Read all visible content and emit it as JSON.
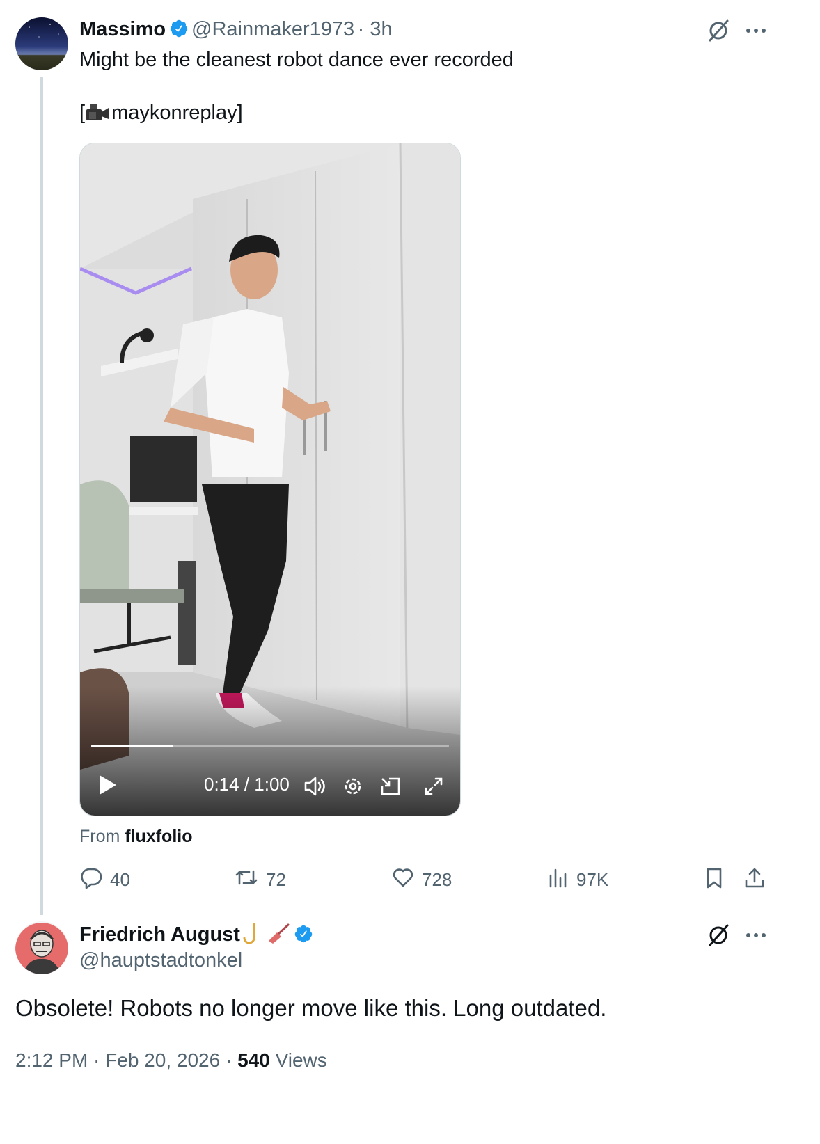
{
  "tweet1": {
    "display_name": "Massimo",
    "handle": "@Rainmaker1973",
    "time": "· 3h",
    "text_line1": "Might be the cleanest robot dance ever recorded",
    "credit_open": "[",
    "credit_name": "maykonreplay]",
    "video": {
      "time_display": "0:14 / 1:00",
      "progress": 0.23
    },
    "source_prefix": "From",
    "source_name": "fluxfolio",
    "actions": {
      "replies": "40",
      "retweets": "72",
      "likes": "728",
      "views": "97K"
    }
  },
  "tweet2": {
    "display_name": "Friedrich August",
    "handle": "@hauptstadtonkel",
    "text": "Obsolete! Robots no longer move like this. Long outdated.",
    "timestamp": "2:12 PM · Feb 20, 2026 ·",
    "views_count": "540",
    "views_label": "Views"
  },
  "colors": {
    "verified": "#1d9bf0",
    "muted": "#536471",
    "text": "#0f1419",
    "thread_line": "#cfd9de"
  },
  "icons": [
    "grok-icon",
    "more-icon",
    "verified-badge-icon",
    "camera-icon",
    "play-icon",
    "volume-icon",
    "settings-icon",
    "pip-icon",
    "fullscreen-icon",
    "reply-icon",
    "retweet-icon",
    "like-icon",
    "views-icon",
    "bookmark-icon",
    "share-icon"
  ]
}
